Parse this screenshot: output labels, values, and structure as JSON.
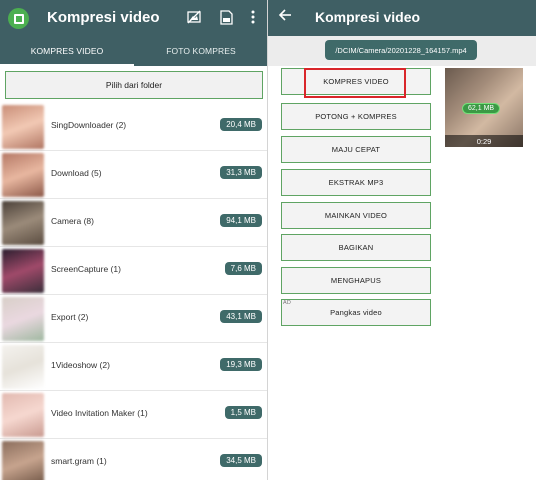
{
  "left": {
    "app_title": "Kompresi video",
    "icons": {
      "logo": "crop-compress-icon",
      "a": "no-image-icon",
      "b": "zip-file-icon",
      "c": "more-vert-icon"
    },
    "tabs": [
      {
        "label": "KOMPRES VIDEO",
        "active": true
      },
      {
        "label": "FOTO KOMPRES",
        "active": false
      }
    ],
    "pick_folder_label": "Pilih dari folder",
    "folders": [
      {
        "name": "SingDownloader (2)",
        "size": "20,4 MB"
      },
      {
        "name": "Download (5)",
        "size": "31,3 MB"
      },
      {
        "name": "Camera (8)",
        "size": "94,1 MB"
      },
      {
        "name": "ScreenCapture (1)",
        "size": "7,6 MB"
      },
      {
        "name": "Export (2)",
        "size": "43,1 MB"
      },
      {
        "name": "1Videoshow (2)",
        "size": "19,3 MB"
      },
      {
        "name": "Video Invitation Maker (1)",
        "size": "1,5 MB"
      },
      {
        "name": "smart.gram (1)",
        "size": "34,5 MB"
      }
    ]
  },
  "right": {
    "title": "Kompresi video",
    "path": "/DCIM/Camera/20201228_164157.mp4",
    "actions": [
      "KOMPRES VIDEO",
      "POTONG + KOMPRES",
      "MAJU CEPAT",
      "EKSTRAK MP3",
      "MAINKAN VIDEO",
      "BAGIKAN",
      "MENGHAPUS",
      "Pangkas video"
    ],
    "ad_label": "AD",
    "video": {
      "size": "62,1 MB",
      "duration": "0:29"
    }
  },
  "colors": {
    "appbar": "#3f5f64",
    "badge": "#3f6a69",
    "accent_green": "#4caf50",
    "highlight": "#d9262a"
  }
}
